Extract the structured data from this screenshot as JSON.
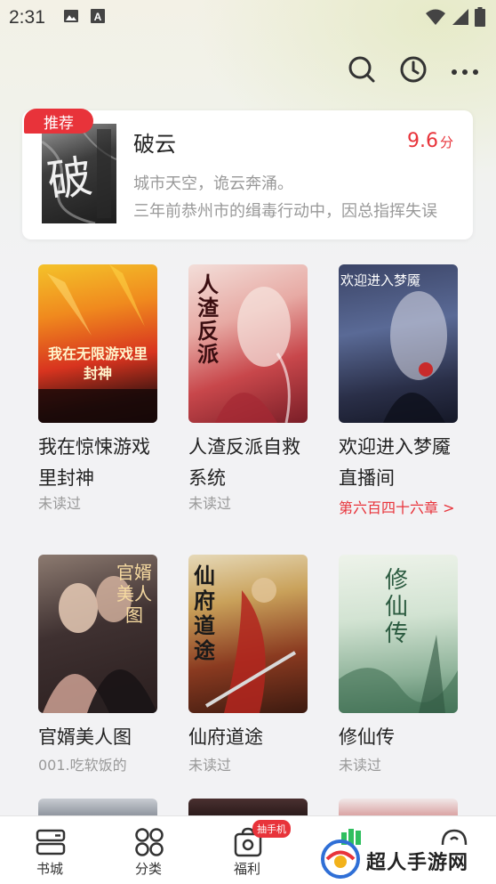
{
  "status_bar": {
    "time": "2:31"
  },
  "featured": {
    "badge": "推荐",
    "title": "破云",
    "rating": "9.6",
    "rating_unit": "分",
    "desc_line1": "城市天空，诡云奔涌。",
    "desc_line2": "三年前恭州市的缉毒行动中，因总指挥失误",
    "cover_char": "破"
  },
  "books": [
    {
      "title": "我在惊悚游戏里封神",
      "sub": "未读过",
      "cover_text": "我在无限游戏里封神"
    },
    {
      "title": "人渣反派自救系统",
      "sub": "未读过",
      "cover_text": "人渣反派"
    },
    {
      "title": "欢迎进入梦魇直播间",
      "sub": "第六百四十六章 >",
      "cover_text": "欢迎进入梦魇"
    },
    {
      "title": "官婿美人图",
      "sub": "001.吃软饭的",
      "cover_text": "官婿美人图"
    },
    {
      "title": "仙府道途",
      "sub": "未读过",
      "cover_text": "仙府道途"
    },
    {
      "title": "修仙传",
      "sub": "未读过",
      "cover_text": "修仙传"
    }
  ],
  "bottom_nav": {
    "items": [
      {
        "label": "书城"
      },
      {
        "label": "分类"
      },
      {
        "label": "福利",
        "badge": "抽手机"
      }
    ]
  },
  "watermark": {
    "text": "超人手游网"
  },
  "colors": {
    "accent": "#e8333a",
    "rating": "#e8333a"
  }
}
